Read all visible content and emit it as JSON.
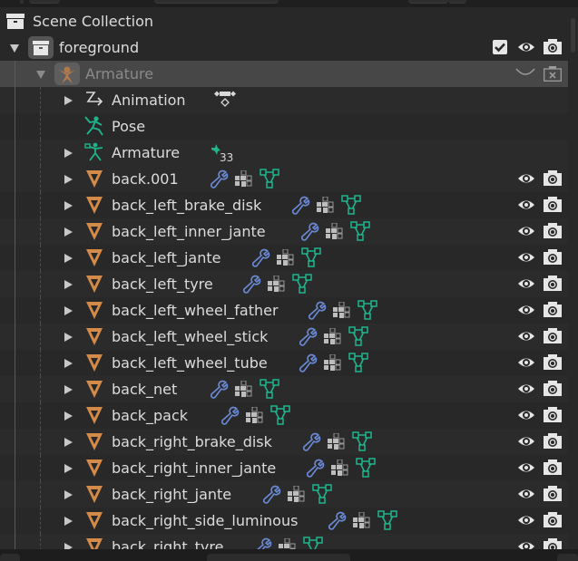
{
  "outliner": {
    "root": {
      "label": "Scene Collection",
      "icon": "collection-icon"
    },
    "collection": {
      "label": "foreground",
      "icon": "collection-box-icon",
      "checked": true
    },
    "armature_object": {
      "label": "Armature",
      "icon": "armature-object-icon",
      "active": true
    },
    "children": [
      {
        "label": "Animation",
        "icon": "animation-icon",
        "badge": "keyframe-action-icon",
        "expandable": true
      },
      {
        "label": "Pose",
        "icon": "pose-icon",
        "expandable": false
      },
      {
        "label": "Armature",
        "icon": "armature-data-icon",
        "badge": "bone-icon",
        "badge_count": "33",
        "expandable": true
      }
    ],
    "objects": [
      {
        "label": "back.001"
      },
      {
        "label": "back_left_brake_disk"
      },
      {
        "label": "back_left_inner_jante"
      },
      {
        "label": "back_left_jante"
      },
      {
        "label": "back_left_tyre"
      },
      {
        "label": "back_left_wheel_father"
      },
      {
        "label": "back_left_wheel_stick"
      },
      {
        "label": "back_left_wheel_tube"
      },
      {
        "label": "back_net"
      },
      {
        "label": "back_pack"
      },
      {
        "label": "back_right_brake_disk"
      },
      {
        "label": "back_right_inner_jante"
      },
      {
        "label": "back_right_jante"
      },
      {
        "label": "back_right_side_luminous"
      },
      {
        "label": "back_right_tyre"
      }
    ],
    "object_icons": [
      "mesh-object-icon",
      "modifier-wrench-icon",
      "vertex-groups-icon",
      "mesh-data-icon"
    ],
    "toggles": [
      "visibility-eye-icon",
      "render-camera-icon"
    ]
  },
  "colors": {
    "background": "#282828",
    "active_row": "#474747",
    "text": "#dcdcdc",
    "mesh_orange": "#d48a49",
    "modifier_blue": "#6b8ad6",
    "data_green": "#1fb58c"
  }
}
